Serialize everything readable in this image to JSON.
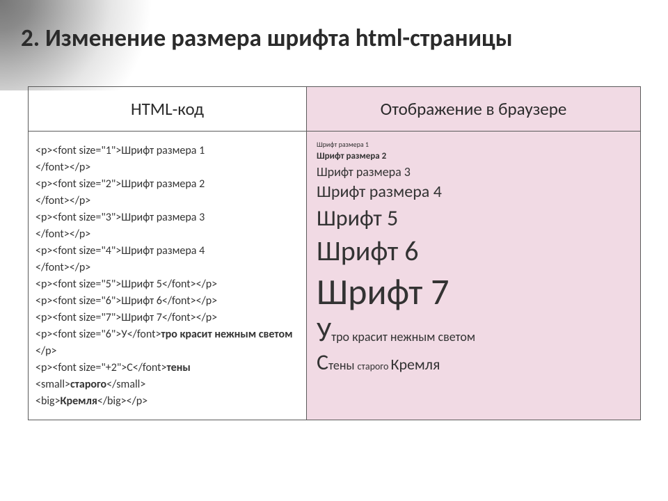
{
  "title": "2. Изменение размера шрифта html-страницы",
  "headers": {
    "left": "HTML-код",
    "right": "Отображение в браузере"
  },
  "code_lines": [
    "<p><font size=\"1\">Шрифт размера 1",
    "</font></p>",
    "<p><font size=\"2\">Шрифт размера 2",
    "</font></p>",
    "<p><font size=\"3\">Шрифт размера 3",
    "</font></p>",
    "<p><font size=\"4\">Шрифт размера 4",
    "</font></p>",
    "<p><font size=\"5\">Шрифт 5</font></p>",
    "<p><font size=\"6\">Шрифт 6</font></p>",
    "<p><font size=\"7\">Шрифт 7</font></p>"
  ],
  "code_poem1_a": "<p><font size=\"6\">У</font>",
  "code_poem1_b": "тро красит нежным светом",
  "code_poem1_c": "</p>",
  "code_poem2_a": "<p><font size=\"+2\">С</font>",
  "code_poem2_b": "тены",
  "code_poem2_c": "<small>",
  "code_poem2_d": "старого",
  "code_poem2_e": "</small>",
  "code_poem2_f": "<big>",
  "code_poem2_g": "Кремля",
  "code_poem2_h": "</big></p>",
  "render": {
    "s1": "Шрифт размера 1",
    "s2": "Шрифт размера  2",
    "s3": "Шрифт размера 3",
    "s4": "Шрифт размера 4",
    "s5": "Шрифт 5",
    "s6": "Шрифт 6",
    "s7": "Шрифт 7",
    "poem1_big": "У",
    "poem1_rest": "тро красит нежным светом",
    "poem2_big": "С",
    "poem2_a": "тены ",
    "poem2_small": "старого ",
    "poem2_bigword": "Кремля"
  }
}
